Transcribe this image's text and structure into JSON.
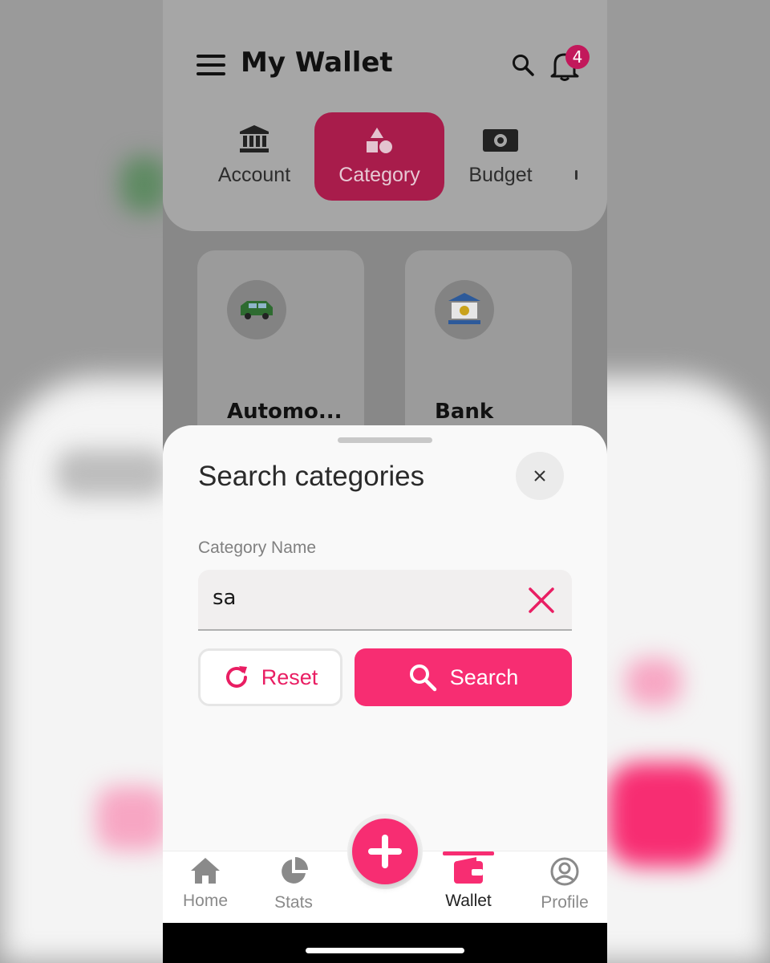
{
  "header": {
    "title": "My Wallet",
    "notification_count": "4"
  },
  "tabs": [
    {
      "label": "Account",
      "icon": "bank-icon",
      "active": false
    },
    {
      "label": "Category",
      "icon": "shapes-icon",
      "active": true
    },
    {
      "label": "Budget",
      "icon": "cash-icon",
      "active": false
    }
  ],
  "categories": [
    {
      "name": "Automo...",
      "icon": "car-icon"
    },
    {
      "name": "Bank",
      "icon": "bank-building-icon"
    }
  ],
  "sheet": {
    "title": "Search categories",
    "field_label": "Category Name",
    "input_value": "sa",
    "reset_label": "Reset",
    "search_label": "Search"
  },
  "bottom_nav": [
    {
      "label": "Home",
      "icon": "home-icon",
      "active": false
    },
    {
      "label": "Stats",
      "icon": "pie-chart-icon",
      "active": false
    },
    {
      "label": "Wallet",
      "icon": "wallet-icon",
      "active": true
    },
    {
      "label": "Profile",
      "icon": "profile-icon",
      "active": false
    }
  ],
  "colors": {
    "accent": "#f72d72",
    "tab_active_dim": "#a81c4b",
    "badge": "#c2185b"
  }
}
